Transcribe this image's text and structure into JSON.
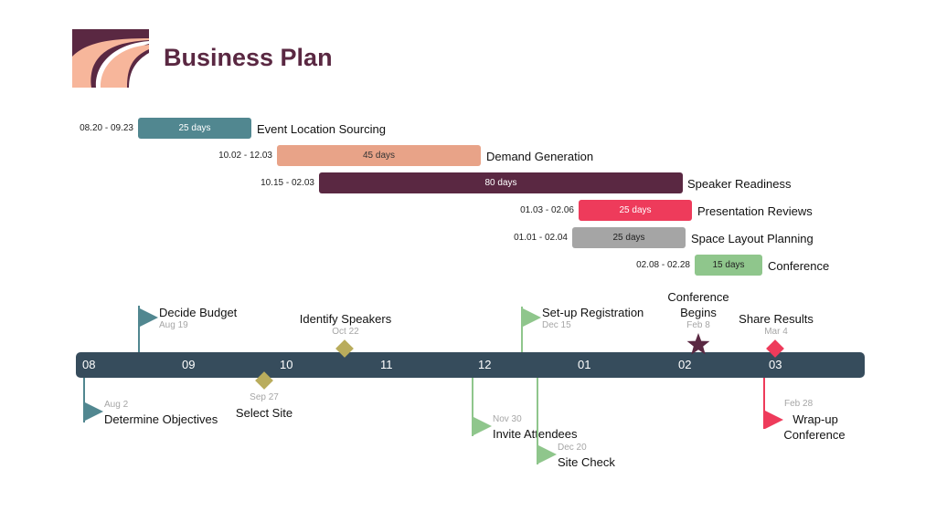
{
  "header": {
    "title": "Business Plan",
    "logo_icon": "business-plan-logo"
  },
  "colors": {
    "teal": "#518790",
    "salmon": "#e8a388",
    "plum": "#5a2842",
    "red": "#ee3b5b",
    "grey": "#a5a5a5",
    "green": "#8fc68c",
    "olive": "#b9ac5c",
    "timeline": "#364c5c",
    "date_grey": "#a6a6a6"
  },
  "tasks": [
    {
      "name": "Event Location Sourcing",
      "range": "08.20 - 09.23",
      "duration": "25 days"
    },
    {
      "name": "Demand Generation",
      "range": "10.02 - 12.03",
      "duration": "45 days"
    },
    {
      "name": "Speaker Readiness",
      "range": "10.15 - 02.03",
      "duration": "80 days"
    },
    {
      "name": "Presentation Reviews",
      "range": "01.03 - 02.06",
      "duration": "25 days"
    },
    {
      "name": "Space Layout Planning",
      "range": "01.01 - 02.04",
      "duration": "25 days"
    },
    {
      "name": "Conference",
      "range": "02.08 - 02.28",
      "duration": "15 days"
    }
  ],
  "timeline": {
    "months": [
      "08",
      "09",
      "10",
      "11",
      "12",
      "01",
      "02",
      "03"
    ]
  },
  "milestones": [
    {
      "label": "Decide Budget",
      "date": "Aug 19",
      "shape": "flag-icon"
    },
    {
      "label": "Identify Speakers",
      "date": "Oct 22",
      "shape": "diamond-icon"
    },
    {
      "label": "Set-up Registration",
      "date": "Dec 15",
      "shape": "flag-icon"
    },
    {
      "label": "Conference Begins",
      "label_line1": "Conference",
      "label_line2": "Begins",
      "date": "Feb 8",
      "shape": "star-icon"
    },
    {
      "label": "Share Results",
      "date": "Mar 4",
      "shape": "diamond-icon"
    },
    {
      "label": "Determine Objectives",
      "date": "Aug 2",
      "shape": "flag-icon"
    },
    {
      "label": "Select Site",
      "date": "Sep 27",
      "shape": "diamond-icon"
    },
    {
      "label": "Invite Attendees",
      "date": "Nov 30",
      "shape": "flag-icon"
    },
    {
      "label": "Site Check",
      "date": "Dec 20",
      "shape": "flag-icon"
    },
    {
      "label": "Wrap-up Conference",
      "label_line1": "Wrap-up",
      "label_line2": "Conference",
      "date": "Feb 28",
      "shape": "flag-icon"
    }
  ]
}
